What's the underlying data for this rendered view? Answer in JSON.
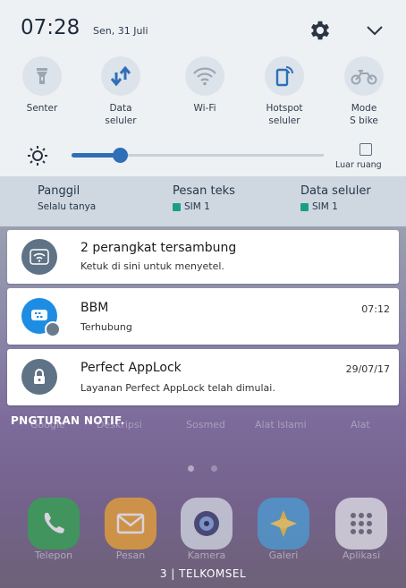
{
  "status": {
    "time": "07:28",
    "date": "Sen, 31 Juli"
  },
  "quick_settings": {
    "tiles": [
      {
        "label": "Senter",
        "icon": "flashlight-icon"
      },
      {
        "label": "Data\nseluler",
        "icon": "mobile-data-icon"
      },
      {
        "label": "Wi-Fi",
        "icon": "wifi-icon"
      },
      {
        "label": "Hotspot\nseluler",
        "icon": "hotspot-icon"
      },
      {
        "label": "Mode\nS bike",
        "icon": "bike-icon"
      }
    ],
    "brightness_level": 0.19,
    "outdoor_label": "Luar ruang"
  },
  "sim_bar": {
    "calls": {
      "title": "Panggil",
      "sub": "Selalu tanya"
    },
    "messages": {
      "title": "Pesan teks",
      "sub": "SIM 1"
    },
    "data": {
      "title": "Data seluler",
      "sub": "SIM 1"
    }
  },
  "notifications": [
    {
      "title": "2 perangkat tersambung",
      "body": "Ketuk di sini untuk menyetel.",
      "time": "",
      "icon": "wifi-hotspot-icon"
    },
    {
      "title": "BBM",
      "body": "Terhubung",
      "time": "07:12",
      "icon": "bbm-icon"
    },
    {
      "title": "Perfect AppLock",
      "body": "Layanan Perfect AppLock telah dimulai.",
      "time": "29/07/17",
      "icon": "lock-icon"
    }
  ],
  "notification_settings_label": "PNGTURAN NOTIF.",
  "home": {
    "ghost_apps": [
      "Google",
      "Deskripsi",
      "Sosmed",
      "Alat Islami",
      "Alat"
    ],
    "dock": [
      "Telepon",
      "Pesan",
      "Kamera",
      "Galeri",
      "Aplikasi"
    ],
    "carrier": "3 | TELKOMSEL"
  },
  "colors": {
    "accent": "#2e6fb7",
    "panel_bg": "#eef1f4",
    "sim_bar_bg": "#cfd8e0",
    "sim_chip": "#1b9e88",
    "bbm_blue": "#1d8de4",
    "icon_grey": "#5f7286"
  }
}
